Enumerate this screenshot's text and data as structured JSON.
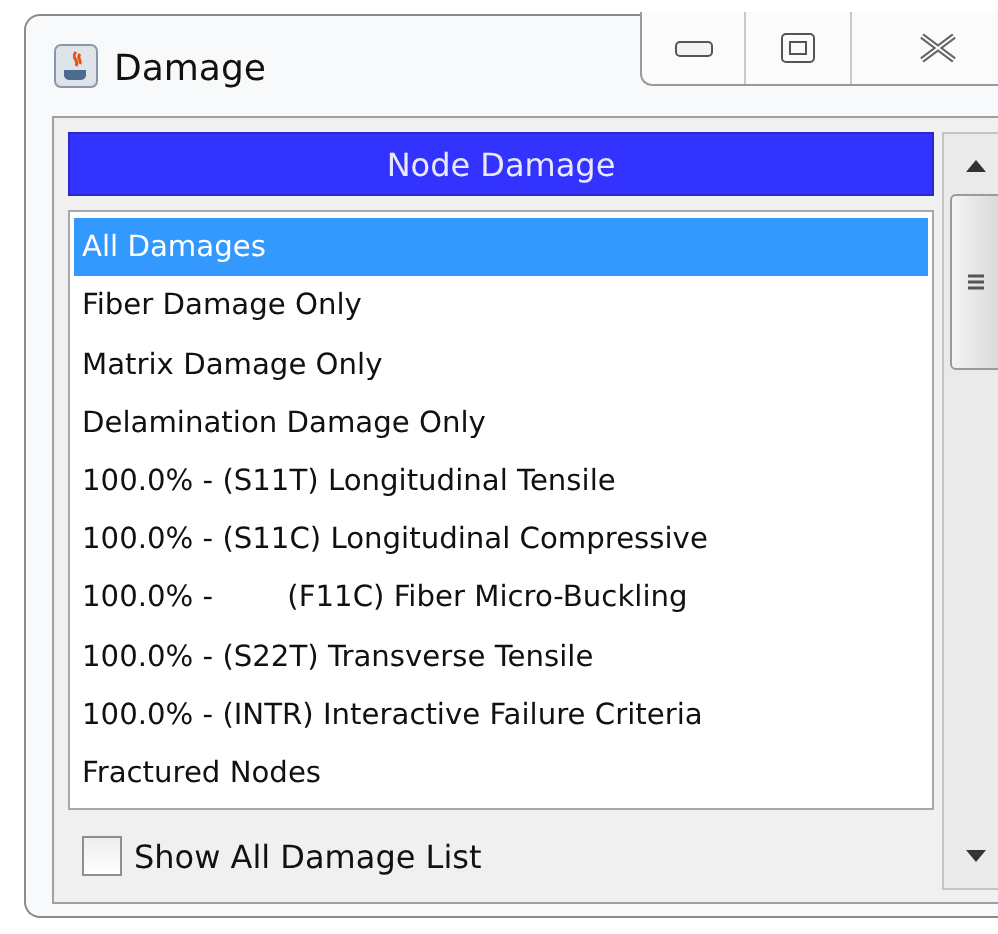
{
  "window": {
    "title": "Damage"
  },
  "header": "Node Damage",
  "items": [
    {
      "label": "All Damages",
      "selected": true
    },
    {
      "label": "Fiber Damage Only",
      "selected": false
    },
    {
      "label": "Matrix Damage Only",
      "selected": false
    },
    {
      "label": "Delamination Damage Only",
      "selected": false
    },
    {
      "label": "100.0% - (S11T) Longitudinal Tensile",
      "selected": false
    },
    {
      "label": "100.0% - (S11C) Longitudinal Compressive",
      "selected": false
    },
    {
      "label": "100.0% -        (F11C) Fiber Micro-Buckling",
      "selected": false
    },
    {
      "label": "100.0% - (S22T) Transverse Tensile",
      "selected": false
    },
    {
      "label": "100.0% - (INTR) Interactive Failure Criteria",
      "selected": false
    },
    {
      "label": "Fractured Nodes",
      "selected": false
    }
  ],
  "show_all": {
    "label": "Show All Damage List",
    "checked": false
  }
}
